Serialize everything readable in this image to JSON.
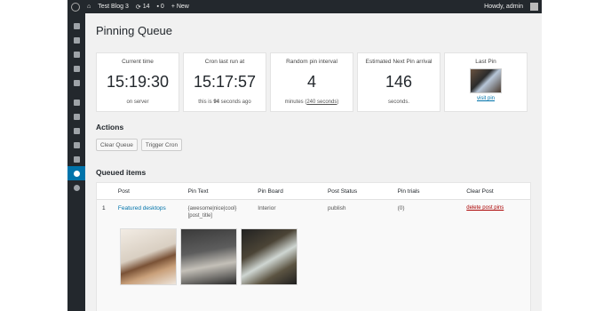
{
  "adminbar": {
    "site_name": "Test Blog 3",
    "updates_count": "14",
    "comments_count": "0",
    "new_label": "+ New",
    "greeting": "Howdy, admin"
  },
  "page": {
    "title": "Pinning Queue"
  },
  "cards": [
    {
      "label": "Current time",
      "value": "15:19:30",
      "sub": "on server"
    },
    {
      "label": "Cron last run at",
      "value": "15:17:57",
      "sub_prefix": "this is ",
      "sub_bold": "94",
      "sub_suffix": " seconds ago"
    },
    {
      "label": "Random pin interval",
      "value": "4",
      "sub_prefix": "minutes (",
      "sub_under": "240 seconds",
      "sub_suffix": ")"
    },
    {
      "label": "Estimated Next Pin arrival",
      "value": "146",
      "sub": "seconds."
    },
    {
      "label": "Last Pin",
      "link": "visit pin"
    }
  ],
  "actions": {
    "heading": "Actions",
    "clear_queue": "Clear Queue",
    "trigger_cron": "Trigger Cron"
  },
  "queue": {
    "heading": "Queued items",
    "columns": [
      "",
      "Post",
      "Pin Text",
      "Pin Board",
      "Post Status",
      "Pin trials",
      "Clear Post"
    ],
    "rows": [
      {
        "num": "1",
        "post": "Featured desktops",
        "pin_text": "{awesome|nice|cool} [post_title]",
        "pin_board": "Interior",
        "post_status": "publish",
        "pin_trials": "(0)",
        "clear": "delete post pins"
      }
    ]
  }
}
